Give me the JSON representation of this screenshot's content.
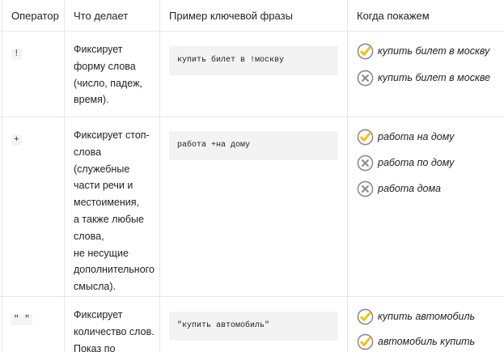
{
  "headers": [
    "Оператор",
    "Что делает",
    "Пример ключевой фразы",
    "Когда покажем"
  ],
  "rows": [
    {
      "operator": "!",
      "desc": [
        "Фиксирует",
        "форму слова",
        "(число, падеж,",
        "время)."
      ],
      "example": "купить билет в !москву",
      "results": [
        {
          "text": "купить билет в москву",
          "status": "yes",
          "icon": "check-circle-icon"
        },
        {
          "text": "купить билет в москве",
          "status": "no",
          "icon": "cross-circle-icon"
        }
      ]
    },
    {
      "operator": "+",
      "desc": [
        "Фиксирует стоп-",
        "слова",
        "(служебные",
        "части речи и",
        "местоимения,",
        "а также любые",
        "слова,",
        "не несущие",
        "дополнительного",
        "смысла)."
      ],
      "example": "работа +на дому",
      "results": [
        {
          "text": "работа на дому",
          "status": "yes",
          "icon": "check-circle-icon"
        },
        {
          "text": "работа по дому",
          "status": "no",
          "icon": "cross-circle-icon"
        },
        {
          "text": "работа дома",
          "status": "no",
          "icon": "cross-circle-icon"
        }
      ]
    },
    {
      "operator": "\" \"",
      "desc": [
        "Фиксирует",
        "количество слов.",
        "Показ по"
      ],
      "example": "\"купить автомобиль\"",
      "results": [
        {
          "text": "купить автомобиль",
          "status": "yes",
          "icon": "check-circle-icon"
        },
        {
          "text": "автомобиль купить",
          "status": "yes",
          "icon": "check-circle-icon"
        }
      ]
    }
  ],
  "colors": {
    "check": "#f6c000",
    "cross": "#8a8a8a",
    "border": "#e6e6e6",
    "code_bg": "#f3f3f3"
  }
}
